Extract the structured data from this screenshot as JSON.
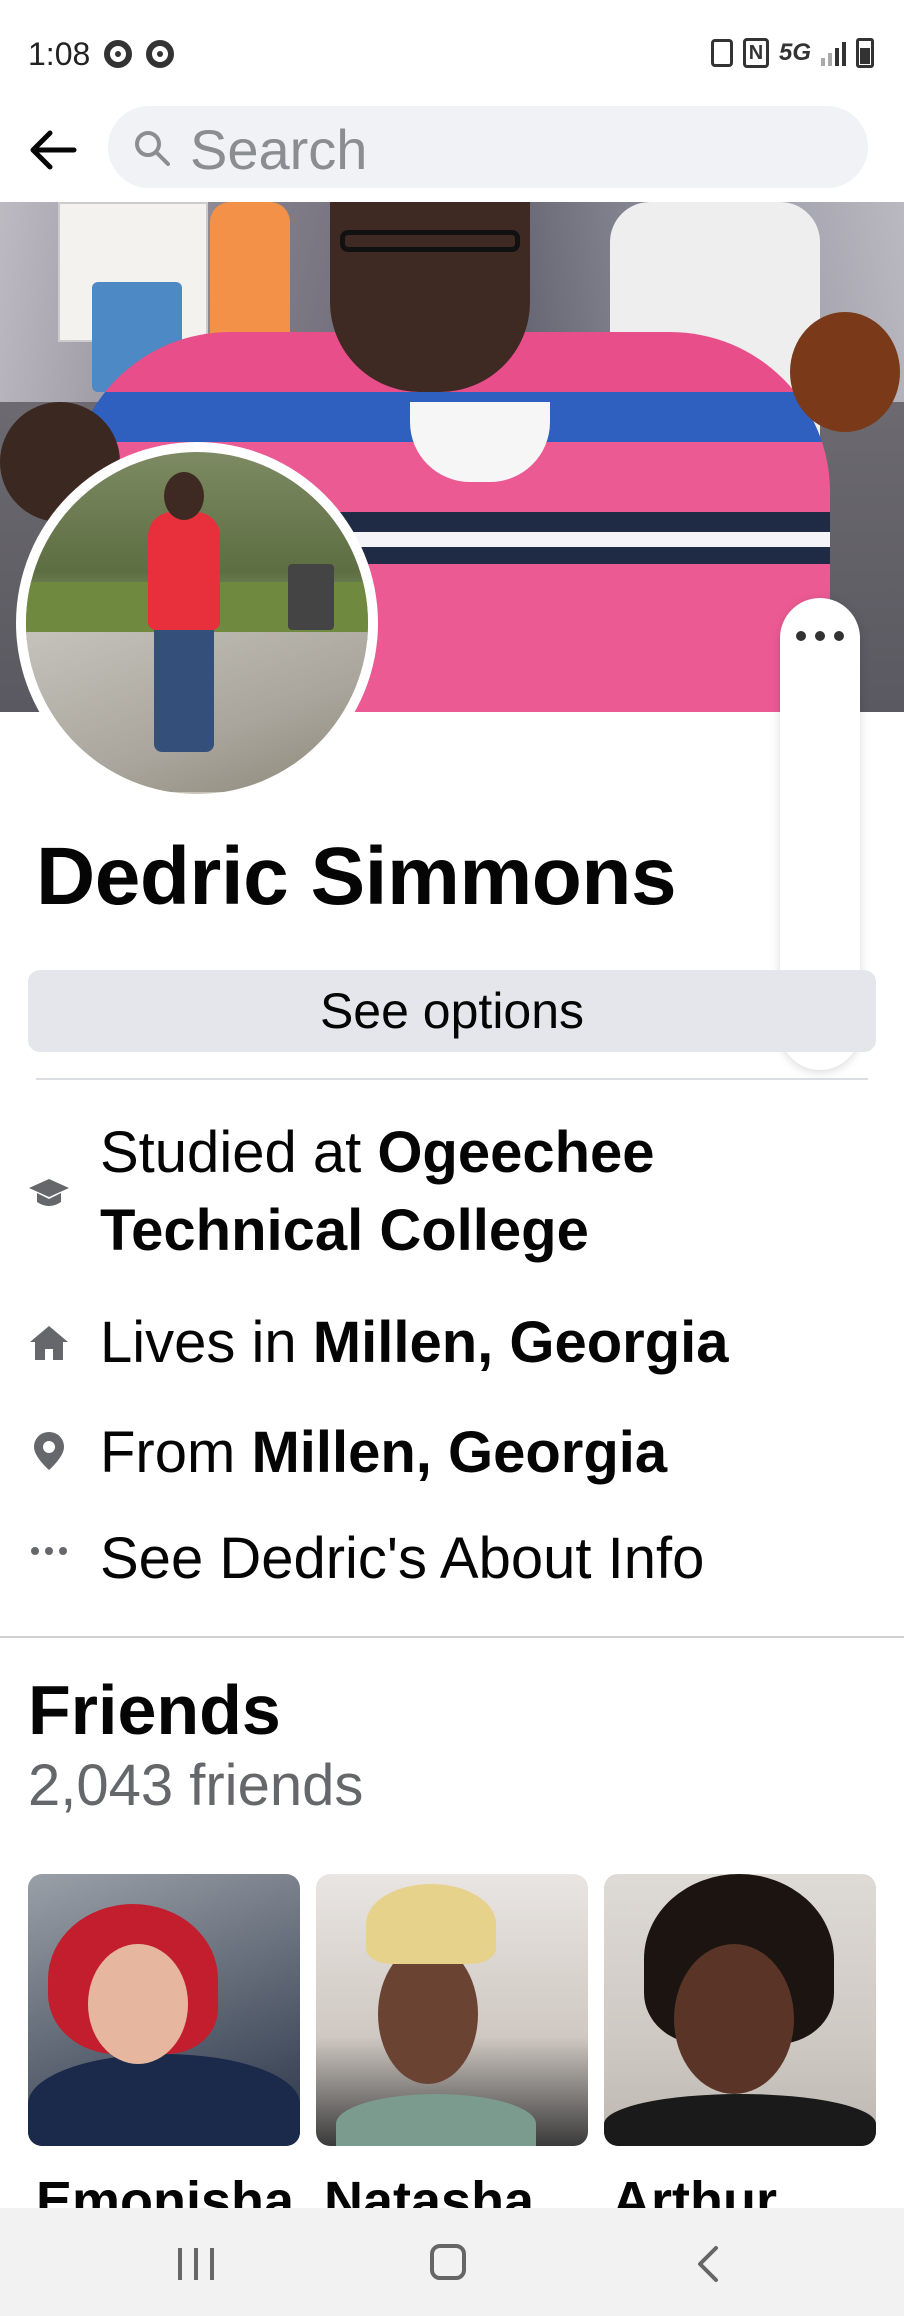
{
  "status_bar": {
    "time": "1:08",
    "network": "5G"
  },
  "search": {
    "placeholder": "Search"
  },
  "profile": {
    "name": "Dedric Simmons",
    "see_options_label": "See options"
  },
  "intro": {
    "studied": {
      "prefix": "Studied at ",
      "value": "Ogeechee Technical College",
      "icon": "graduation-cap-icon"
    },
    "lives": {
      "prefix": "Lives in ",
      "value": "Millen, Georgia",
      "icon": "home-icon"
    },
    "from": {
      "prefix": "From ",
      "value": "Millen, Georgia",
      "icon": "location-pin-icon"
    },
    "about": {
      "label": "See Dedric's About Info",
      "icon": "more-horizontal-icon"
    }
  },
  "friends": {
    "title": "Friends",
    "count": "2,043 friends",
    "items": [
      {
        "name": "Emonisha"
      },
      {
        "name": "Natasha"
      },
      {
        "name": "Arthur"
      }
    ]
  },
  "colors": {
    "button_bg": "#e4e6eb",
    "secondary_text": "#65676b",
    "search_bg": "#f0f2f5"
  }
}
